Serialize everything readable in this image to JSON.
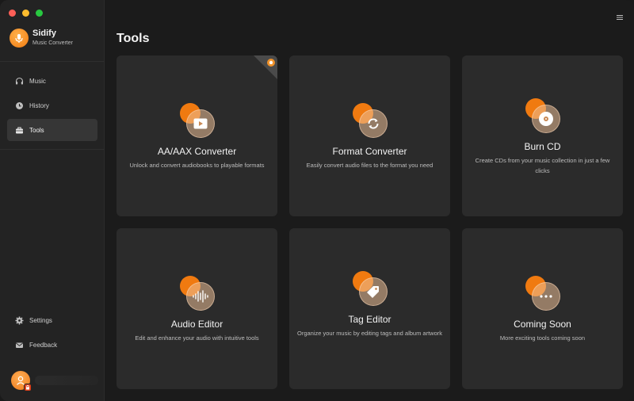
{
  "app": {
    "name": "Sidify",
    "subtitle": "Music Converter"
  },
  "sidebar": {
    "nav": [
      {
        "label": "Music",
        "icon": "headphones-icon"
      },
      {
        "label": "History",
        "icon": "clock-icon"
      },
      {
        "label": "Tools",
        "icon": "toolbox-icon",
        "active": true
      }
    ],
    "bottom": [
      {
        "label": "Settings",
        "icon": "gear-icon"
      },
      {
        "label": "Feedback",
        "icon": "mail-icon"
      }
    ]
  },
  "main": {
    "title": "Tools",
    "cards": [
      {
        "title": "AA/AAX Converter",
        "desc": "Unlock and convert audiobooks to playable formats",
        "icon": "play-icon"
      },
      {
        "title": "Format Converter",
        "desc": "Easily convert audio files to the format you need",
        "icon": "refresh-icon"
      },
      {
        "title": "Burn CD",
        "desc": "Create CDs from your music collection in just a few clicks",
        "icon": "disc-icon"
      },
      {
        "title": "Audio Editor",
        "desc": "Edit and enhance your audio with intuitive tools",
        "icon": "waveform-icon"
      },
      {
        "title": "Tag Editor",
        "desc": "Organize your music by editing tags and album artwork",
        "icon": "tag-icon"
      },
      {
        "title": "Coming Soon",
        "desc": "More exciting tools coming soon",
        "icon": "more-icon"
      }
    ]
  },
  "colors": {
    "accent": "#f07a10",
    "background": "#1b1b1b",
    "card": "#2b2b2b",
    "sidebar": "#232323"
  }
}
